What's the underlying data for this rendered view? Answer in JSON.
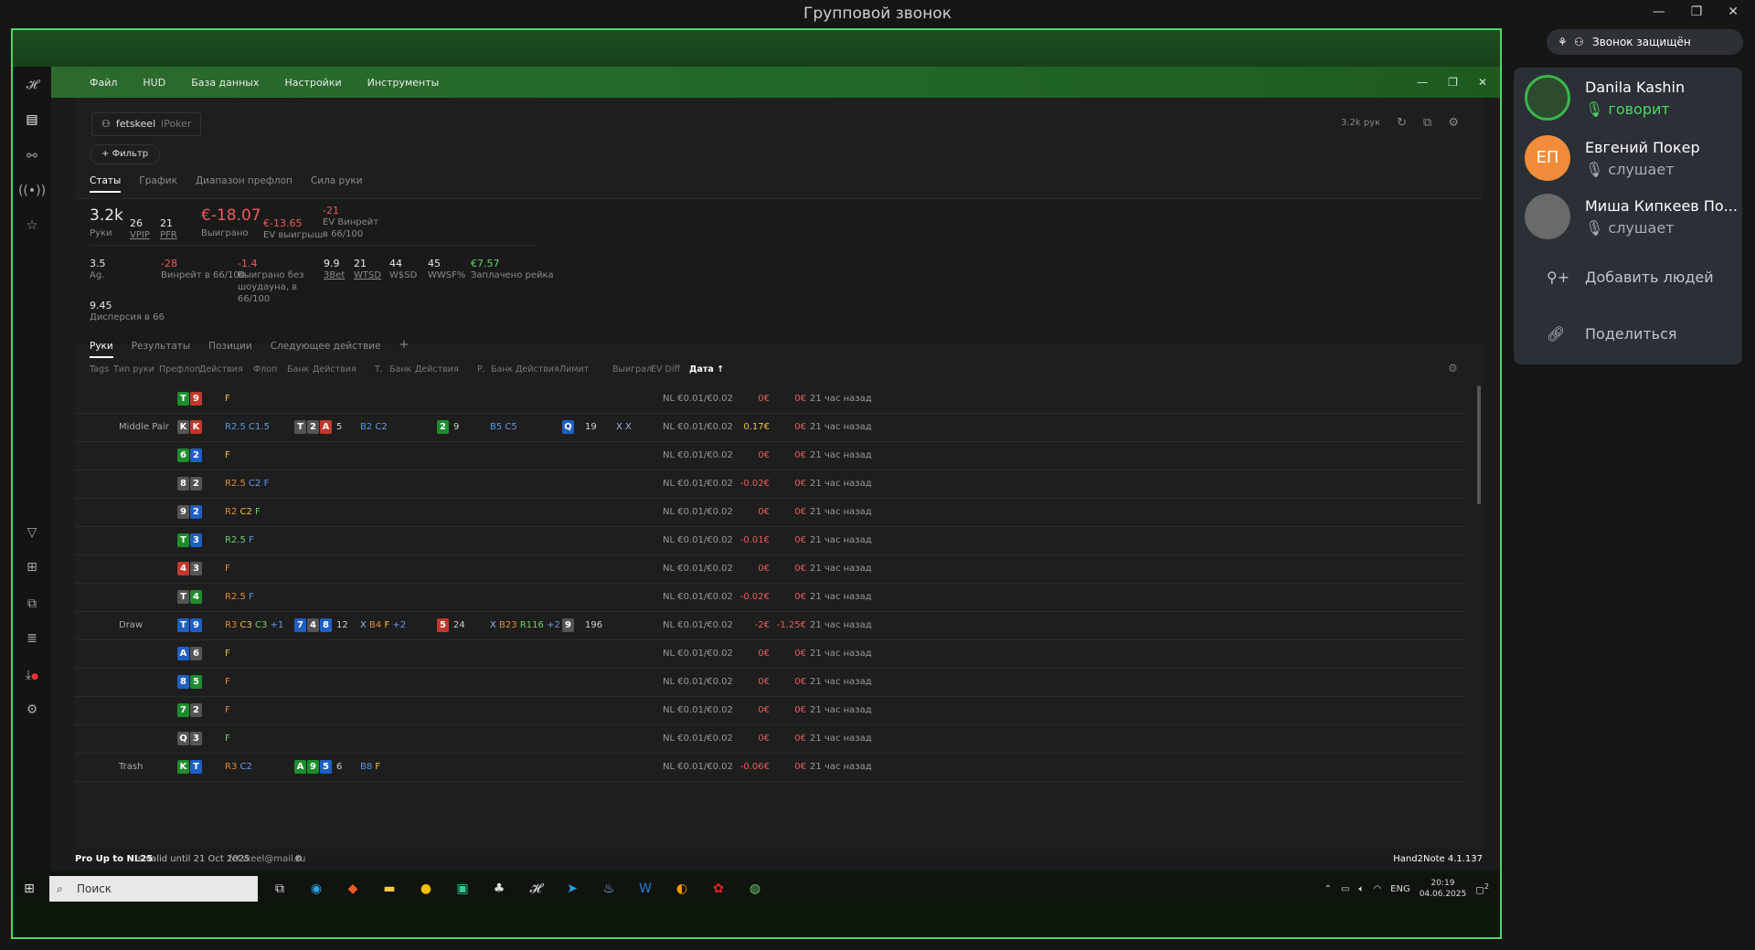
{
  "window": {
    "title": "Групповой звонок"
  },
  "call": {
    "secure_label": "Звонок защищён",
    "participants": [
      {
        "name": "Danila Kashin",
        "status": "говорит"
      },
      {
        "name": "Евгений Покер",
        "initials": "ЕП",
        "status": "слушает"
      },
      {
        "name": "Миша Кипкеев По...",
        "status": "слушает"
      }
    ],
    "add_people": "Добавить людей",
    "share": "Поделиться"
  },
  "app": {
    "menu": [
      "Файл",
      "HUD",
      "База данных",
      "Настройки",
      "Инструменты"
    ],
    "player": {
      "name": "fetskeel",
      "site": "iPoker"
    },
    "filter_label": "Фильтр",
    "hands_count": "3.2k рук",
    "tabs": [
      "Статы",
      "График",
      "Диапазон префлоп",
      "Сила руки"
    ],
    "stats": {
      "hands": {
        "v": "3.2k",
        "l": "Руки"
      },
      "vpip": {
        "v": "26",
        "l": "VPIP"
      },
      "pfr": {
        "v": "21",
        "l": "PFR"
      },
      "won": {
        "v": "€-18.07",
        "l": "Выиграно"
      },
      "ev": {
        "v": "€-13.65",
        "l": "EV выигрыш"
      },
      "evbb": {
        "v": "-21",
        "l": "EV Винрейт в 66/100"
      },
      "ag": {
        "v": "3.5",
        "l": "Ag."
      },
      "winrate": {
        "v": "-28",
        "l": "Винрейт в 66/100"
      },
      "nosd": {
        "v": "-1.4",
        "l": "Выиграно без шоудауна, в 66/100"
      },
      "threebet": {
        "v": "9.9",
        "l": "3Bet"
      },
      "wtsd": {
        "v": "21",
        "l": "WTSD"
      },
      "wsd": {
        "v": "44",
        "l": "W$SD"
      },
      "wwsf": {
        "v": "45",
        "l": "WWSF%"
      },
      "rake": {
        "v": "€7.57",
        "l": "Заплачено рейка"
      },
      "disp": {
        "v": "9.45",
        "l": "Дисперсия в 66"
      }
    },
    "subtabs": [
      "Руки",
      "Результаты",
      "Позиции",
      "Следующее действие",
      "+"
    ],
    "columns": [
      "Tags",
      "Тип руки",
      "Префлоп",
      "Действия",
      "Флоп",
      "Банк",
      "Действия",
      "Т.",
      "Банк",
      "Действия",
      "Р.",
      "Банк",
      "Действия",
      "Лимит",
      "Выиграл",
      "EV Diff",
      "Дата ↑"
    ],
    "rows": [
      {
        "type": "",
        "hand": [
          [
            "T",
            "cl"
          ],
          [
            "9",
            "h"
          ]
        ],
        "pre": [
          [
            "F",
            "af"
          ]
        ],
        "flop": [],
        "fb": "",
        "fa": [],
        "turn": [],
        "tb": "",
        "ta": [],
        "river": [],
        "rb": "",
        "ra": [],
        "limit": "NL €0.01/€0.02",
        "won": "0€",
        "ev": "0€",
        "date": "21 час назад"
      },
      {
        "type": "Middle Pair",
        "hand": [
          [
            "K",
            "s"
          ],
          [
            "K",
            "h"
          ]
        ],
        "pre": [
          [
            "R2.5",
            "ab"
          ],
          [
            "C1.5",
            "ac"
          ]
        ],
        "flop": [
          [
            "T",
            "s"
          ],
          [
            "2",
            "s"
          ],
          [
            "A",
            "h"
          ]
        ],
        "fb": "5",
        "fa": [
          [
            "B2",
            "ab"
          ],
          [
            "C2",
            "ac"
          ]
        ],
        "turn": [
          [
            "2",
            "cl"
          ]
        ],
        "tb": "9",
        "ta": [
          [
            "B5",
            "ab"
          ],
          [
            "C5",
            "ac"
          ]
        ],
        "river": [
          [
            "Q",
            "d"
          ]
        ],
        "rb": "19",
        "ra": [
          [
            "X",
            "ax"
          ],
          [
            "X",
            "ax"
          ]
        ],
        "limit": "NL €0.01/€0.02",
        "won": "0.17€",
        "ev": "0€",
        "date": "21 час назад"
      },
      {
        "type": "",
        "hand": [
          [
            "6",
            "cl"
          ],
          [
            "2",
            "d"
          ]
        ],
        "pre": [
          [
            "F",
            "af"
          ]
        ],
        "flop": [],
        "fb": "",
        "fa": [],
        "turn": [],
        "tb": "",
        "ta": [],
        "river": [],
        "rb": "",
        "ra": [],
        "limit": "NL €0.01/€0.02",
        "won": "0€",
        "ev": "0€",
        "date": "21 час назад"
      },
      {
        "type": "",
        "hand": [
          [
            "8",
            "s"
          ],
          [
            "2",
            "s"
          ]
        ],
        "pre": [
          [
            "R2.5",
            "ar"
          ],
          [
            "C2",
            "ac"
          ],
          [
            "F",
            "ab"
          ]
        ],
        "flop": [],
        "fb": "",
        "fa": [],
        "turn": [],
        "tb": "",
        "ta": [],
        "river": [],
        "rb": "",
        "ra": [],
        "limit": "NL €0.01/€0.02",
        "won": "-0.02€",
        "ev": "0€",
        "date": "21 час назад"
      },
      {
        "type": "",
        "hand": [
          [
            "9",
            "s"
          ],
          [
            "2",
            "d"
          ]
        ],
        "pre": [
          [
            "R2",
            "ar"
          ],
          [
            "C2",
            "af"
          ],
          [
            "F",
            "pos"
          ]
        ],
        "flop": [],
        "fb": "",
        "fa": [],
        "turn": [],
        "tb": "",
        "ta": [],
        "river": [],
        "rb": "",
        "ra": [],
        "limit": "NL €0.01/€0.02",
        "won": "0€",
        "ev": "0€",
        "date": "21 час назад"
      },
      {
        "type": "",
        "hand": [
          [
            "T",
            "cl"
          ],
          [
            "3",
            "d"
          ]
        ],
        "pre": [
          [
            "R2.5",
            "pos"
          ],
          [
            "F",
            "ab"
          ]
        ],
        "flop": [],
        "fb": "",
        "fa": [],
        "turn": [],
        "tb": "",
        "ta": [],
        "river": [],
        "rb": "",
        "ra": [],
        "limit": "NL €0.01/€0.02",
        "won": "-0.01€",
        "ev": "0€",
        "date": "21 час назад"
      },
      {
        "type": "",
        "hand": [
          [
            "4",
            "h"
          ],
          [
            "3",
            "s"
          ]
        ],
        "pre": [
          [
            "F",
            "ar"
          ]
        ],
        "flop": [],
        "fb": "",
        "fa": [],
        "turn": [],
        "tb": "",
        "ta": [],
        "river": [],
        "rb": "",
        "ra": [],
        "limit": "NL €0.01/€0.02",
        "won": "0€",
        "ev": "0€",
        "date": "21 час назад"
      },
      {
        "type": "",
        "hand": [
          [
            "T",
            "s"
          ],
          [
            "4",
            "cl"
          ]
        ],
        "pre": [
          [
            "R2.5",
            "ar"
          ],
          [
            "F",
            "ab"
          ]
        ],
        "flop": [],
        "fb": "",
        "fa": [],
        "turn": [],
        "tb": "",
        "ta": [],
        "river": [],
        "rb": "",
        "ra": [],
        "limit": "NL €0.01/€0.02",
        "won": "-0.02€",
        "ev": "0€",
        "date": "21 час назад"
      },
      {
        "type": "Draw",
        "hand": [
          [
            "T",
            "d"
          ],
          [
            "9",
            "d"
          ]
        ],
        "pre": [
          [
            "R3",
            "ar"
          ],
          [
            "C3",
            "af"
          ],
          [
            "C3",
            "pos"
          ],
          [
            "+1",
            "ac"
          ]
        ],
        "flop": [
          [
            "7",
            "d"
          ],
          [
            "4",
            "s"
          ],
          [
            "8",
            "d"
          ]
        ],
        "fb": "12",
        "fa": [
          [
            "X",
            "ax"
          ],
          [
            "B4",
            "ar"
          ],
          [
            "F",
            "af"
          ],
          [
            "+2",
            "ac"
          ]
        ],
        "turn": [
          [
            "5",
            "h"
          ]
        ],
        "tb": "24",
        "ta": [
          [
            "X",
            "ax"
          ],
          [
            "B23",
            "ar"
          ],
          [
            "R116",
            "pos"
          ],
          [
            "+2",
            "ac"
          ]
        ],
        "river": [
          [
            "9",
            "s"
          ]
        ],
        "rb": "196",
        "ra": [],
        "limit": "NL €0.01/€0.02",
        "won": "-2€",
        "ev": "-1.25€",
        "date": "21 час назад"
      },
      {
        "type": "",
        "hand": [
          [
            "A",
            "d"
          ],
          [
            "6",
            "s"
          ]
        ],
        "pre": [
          [
            "F",
            "af"
          ]
        ],
        "flop": [],
        "fb": "",
        "fa": [],
        "turn": [],
        "tb": "",
        "ta": [],
        "river": [],
        "rb": "",
        "ra": [],
        "limit": "NL €0.01/€0.02",
        "won": "0€",
        "ev": "0€",
        "date": "21 час назад"
      },
      {
        "type": "",
        "hand": [
          [
            "8",
            "d"
          ],
          [
            "5",
            "cl"
          ]
        ],
        "pre": [
          [
            "F",
            "ar"
          ]
        ],
        "flop": [],
        "fb": "",
        "fa": [],
        "turn": [],
        "tb": "",
        "ta": [],
        "river": [],
        "rb": "",
        "ra": [],
        "limit": "NL €0.01/€0.02",
        "won": "0€",
        "ev": "0€",
        "date": "21 час назад"
      },
      {
        "type": "",
        "hand": [
          [
            "7",
            "cl"
          ],
          [
            "2",
            "s"
          ]
        ],
        "pre": [
          [
            "F",
            "ar"
          ]
        ],
        "flop": [],
        "fb": "",
        "fa": [],
        "turn": [],
        "tb": "",
        "ta": [],
        "river": [],
        "rb": "",
        "ra": [],
        "limit": "NL €0.01/€0.02",
        "won": "0€",
        "ev": "0€",
        "date": "21 час назад"
      },
      {
        "type": "",
        "hand": [
          [
            "Q",
            "s"
          ],
          [
            "3",
            "s"
          ]
        ],
        "pre": [
          [
            "F",
            "pos"
          ]
        ],
        "flop": [],
        "fb": "",
        "fa": [],
        "turn": [],
        "tb": "",
        "ta": [],
        "river": [],
        "rb": "",
        "ra": [],
        "limit": "NL €0.01/€0.02",
        "won": "0€",
        "ev": "0€",
        "date": "21 час назад"
      },
      {
        "type": "Trash",
        "hand": [
          [
            "K",
            "cl"
          ],
          [
            "T",
            "d"
          ]
        ],
        "pre": [
          [
            "R3",
            "ar"
          ],
          [
            "C2",
            "ac"
          ]
        ],
        "flop": [
          [
            "A",
            "cl"
          ],
          [
            "9",
            "cl"
          ],
          [
            "5",
            "d"
          ]
        ],
        "fb": "6",
        "fa": [
          [
            "B8",
            "ab"
          ],
          [
            "F",
            "af"
          ]
        ],
        "turn": [],
        "tb": "",
        "ta": [],
        "river": [],
        "rb": "",
        "ra": [],
        "limit": "NL €0.01/€0.02",
        "won": "-0.06€",
        "ev": "0€",
        "date": "21 час назад"
      }
    ],
    "footer": {
      "license": "Pro Up to NL25",
      "valid": "is valid until 21 Oct 2025",
      "email": "fetskeel@mail.ru",
      "version": "Hand2Note 4.1.137"
    }
  },
  "taskbar": {
    "search": "Поиск",
    "lang": "ENG",
    "time": "20:19",
    "date": "04.06.2025",
    "notif": "2"
  }
}
